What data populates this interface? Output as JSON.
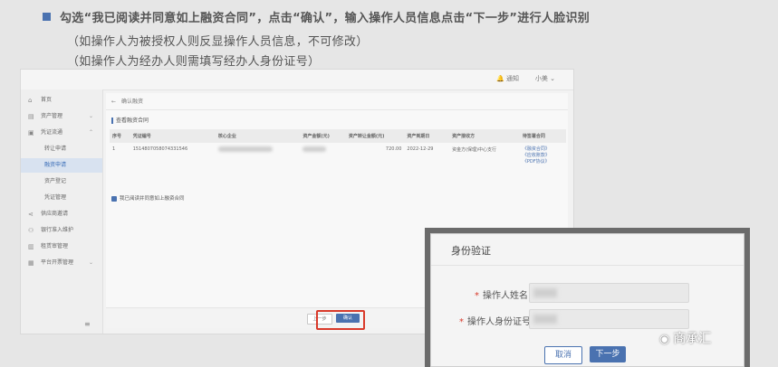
{
  "instructions": {
    "line1": "勾选“我已阅读并同意如上融资合同”，点击“确认”，输入操作人员信息点击“下一步”进行人脸识别",
    "line2": "（如操作人为被授权人则反显操作人员信息，不可修改）",
    "line3": "（如操作人为经办人则需填写经办人身份证号）"
  },
  "topbar": {
    "notice": "通知",
    "user": "小美"
  },
  "sidebar": {
    "items": [
      {
        "label": "首页",
        "icon": "home-icon",
        "glyph": "⌂"
      },
      {
        "label": "资产管理",
        "icon": "asset-icon",
        "glyph": "▤",
        "chevron": "⌄"
      },
      {
        "label": "凭证流通",
        "icon": "voucher-icon",
        "glyph": "▣",
        "chevron": "⌃"
      },
      {
        "label": "转让申请",
        "sub": true
      },
      {
        "label": "融资申请",
        "sub": true,
        "active": true
      },
      {
        "label": "资产登记",
        "sub": true
      },
      {
        "label": "凭证管理",
        "sub": true
      },
      {
        "label": "供应商邀请",
        "icon": "share-icon",
        "glyph": "⋖"
      },
      {
        "label": "银行准入维护",
        "icon": "bank-icon",
        "glyph": "⚇"
      },
      {
        "label": "租赁审管理",
        "icon": "doc-icon",
        "glyph": "▥"
      },
      {
        "label": "平台开票管理",
        "icon": "invoice-icon",
        "glyph": "▦",
        "chevron": "⌄"
      }
    ],
    "footer": "≡"
  },
  "content": {
    "breadcrumb": "确认融资",
    "section_title": "查看融资合同",
    "table": {
      "headers": [
        "序号",
        "凭证编号",
        "核心企业",
        "资产金额(元)",
        "资产转让金额(元)",
        "资产到期日",
        "资产接收方",
        "待签署合同"
      ],
      "rows": [
        {
          "index": "1",
          "voucher": "1514807058074331546",
          "amount2": "720.00",
          "due": "2022-12-29",
          "receiver": "资金方(保理)中心支行",
          "contracts": [
            "《融资合同》",
            "《应收账款》",
            "《PDF协议》"
          ]
        }
      ]
    },
    "agree_text": "我已阅读并同意如上融资合同",
    "prev_label": "上一步",
    "confirm_label": "确认"
  },
  "dialog": {
    "title": "身份验证",
    "name_label": "操作人姓名",
    "id_label": "操作人身份证号",
    "cancel_label": "取消",
    "next_label": "下一步"
  },
  "watermark": {
    "text": "商承汇",
    "icon": "wechat-icon"
  },
  "colors": {
    "accent": "#4a72b0",
    "highlight": "#d93a2b"
  }
}
